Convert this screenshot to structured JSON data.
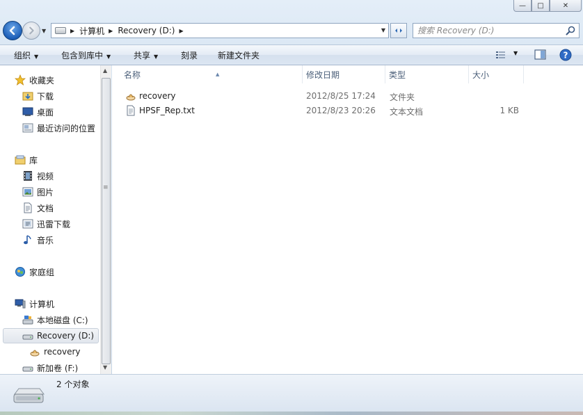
{
  "window": {
    "minimize_glyph": "—",
    "maximize_glyph": "□",
    "close_glyph": "✕"
  },
  "address_bar": {
    "breadcrumbs": [
      "计算机",
      "Recovery (D:)"
    ]
  },
  "search": {
    "placeholder": "搜索 Recovery (D:)"
  },
  "toolbar": {
    "organize": "组织",
    "include_in_library": "包含到库中",
    "share": "共享",
    "burn": "刻录",
    "new_folder": "新建文件夹"
  },
  "nav": {
    "favorites_label": "收藏夹",
    "favorites": [
      "下载",
      "桌面",
      "最近访问的位置"
    ],
    "libraries_label": "库",
    "libraries": [
      "视频",
      "图片",
      "文档",
      "迅雷下载",
      "音乐"
    ],
    "homegroup_label": "家庭组",
    "computer_label": "计算机",
    "drives": [
      "本地磁盘 (C:)",
      "Recovery (D:)"
    ],
    "subfolder": "recovery",
    "more_drive": "新加卷 (F:)"
  },
  "columns": {
    "name": "名称",
    "modified": "修改日期",
    "type": "类型",
    "size": "大小"
  },
  "files": [
    {
      "name": "recovery",
      "modified": "2012/8/25 17:24",
      "type": "文件夹",
      "size": ""
    },
    {
      "name": "HPSF_Rep.txt",
      "modified": "2012/8/23 20:26",
      "type": "文本文档",
      "size": "1 KB"
    }
  ],
  "status": {
    "count_text": "2 个对象"
  },
  "colors": {
    "accent": "#1d5fb8",
    "header_text": "#4c607a",
    "selection_bg": "#e1e6ed"
  }
}
